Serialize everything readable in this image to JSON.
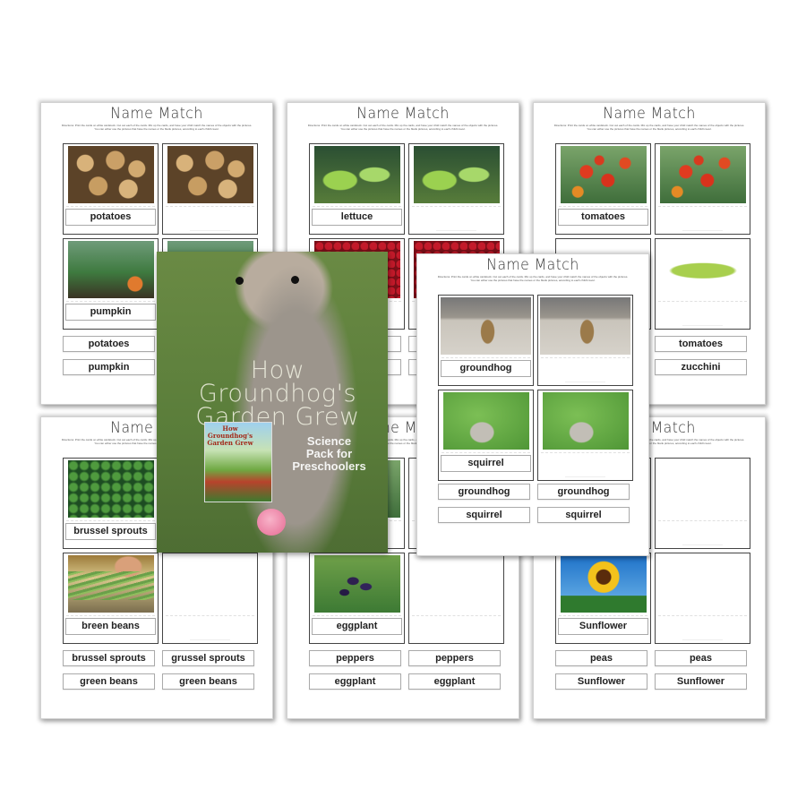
{
  "worksheet_title": "Name Match",
  "worksheet_directions": "Directions: Print the cards on white cardstock. Cut out each of the cards. Mix up the cards, and have your child match the names of the objects with the pictures. You can either use the pictures that have the names or the blank pictures, according to each child's level.",
  "pages": [
    {
      "id": "top-left",
      "cards": [
        {
          "image": "potatoes-photo",
          "label": "potatoes"
        },
        {
          "image": "potatoes-photo",
          "label": ""
        },
        {
          "image": "pumpkin-photo",
          "label": "pumpkin"
        },
        {
          "image": "pumpkin-photo",
          "label": ""
        }
      ],
      "words": [
        "potatoes",
        "",
        "pumpkin",
        ""
      ]
    },
    {
      "id": "top-middle",
      "cards": [
        {
          "image": "lettuce-photo",
          "label": "lettuce"
        },
        {
          "image": "lettuce-photo",
          "label": ""
        },
        {
          "image": "berries-photo",
          "label": ""
        },
        {
          "image": "berries-photo",
          "label": ""
        }
      ],
      "words": [
        "",
        "",
        "",
        ""
      ]
    },
    {
      "id": "top-right",
      "cards": [
        {
          "image": "tomatoes-photo",
          "label": "tomatoes"
        },
        {
          "image": "tomatoes-photo",
          "label": ""
        },
        {
          "image": "",
          "label": ""
        },
        {
          "image": "zucchini-photo",
          "label": ""
        }
      ],
      "words": [
        "",
        "tomatoes",
        "",
        "zucchini"
      ]
    },
    {
      "id": "bottom-left",
      "cards": [
        {
          "image": "brussel-sprouts-photo",
          "label": "brussel sprouts"
        },
        {
          "image": "",
          "label": ""
        },
        {
          "image": "green-beans-photo",
          "label": "breen beans"
        },
        {
          "image": "",
          "label": ""
        }
      ],
      "words": [
        "brussel sprouts",
        "grussel sprouts",
        "green beans",
        "green beans"
      ]
    },
    {
      "id": "bottom-middle",
      "cards": [
        {
          "image": "peppers-photo",
          "label": ""
        },
        {
          "image": "",
          "label": ""
        },
        {
          "image": "eggplant-photo",
          "label": "eggplant"
        },
        {
          "image": "",
          "label": ""
        }
      ],
      "words": [
        "peppers",
        "peppers",
        "eggplant",
        "eggplant"
      ]
    },
    {
      "id": "bottom-right",
      "cards": [
        {
          "image": "",
          "label": ""
        },
        {
          "image": "",
          "label": ""
        },
        {
          "image": "sunflower-photo",
          "label": "Sunflower"
        },
        {
          "image": "",
          "label": ""
        }
      ],
      "words": [
        "peas",
        "peas",
        "Sunflower",
        "Sunflower"
      ]
    },
    {
      "id": "front-groundhog",
      "cards": [
        {
          "image": "groundhog-photo",
          "label": "groundhog"
        },
        {
          "image": "groundhog-photo",
          "label": ""
        },
        {
          "image": "squirrel-photo",
          "label": "squirrel"
        },
        {
          "image": "squirrel-photo",
          "label": ""
        }
      ],
      "words": [
        "groundhog",
        "groundhog",
        "squirrel",
        "squirrel"
      ]
    }
  ],
  "cover": {
    "title_line1": "How",
    "title_line2": "Groundhog's",
    "title_line3": "Garden Grew",
    "subtitle_line1": "Science",
    "subtitle_line2": "Pack for",
    "subtitle_line3": "Preschoolers",
    "book_title": "How Groundhog's Garden Grew",
    "image": "groundhog-holding-flower-photo"
  }
}
